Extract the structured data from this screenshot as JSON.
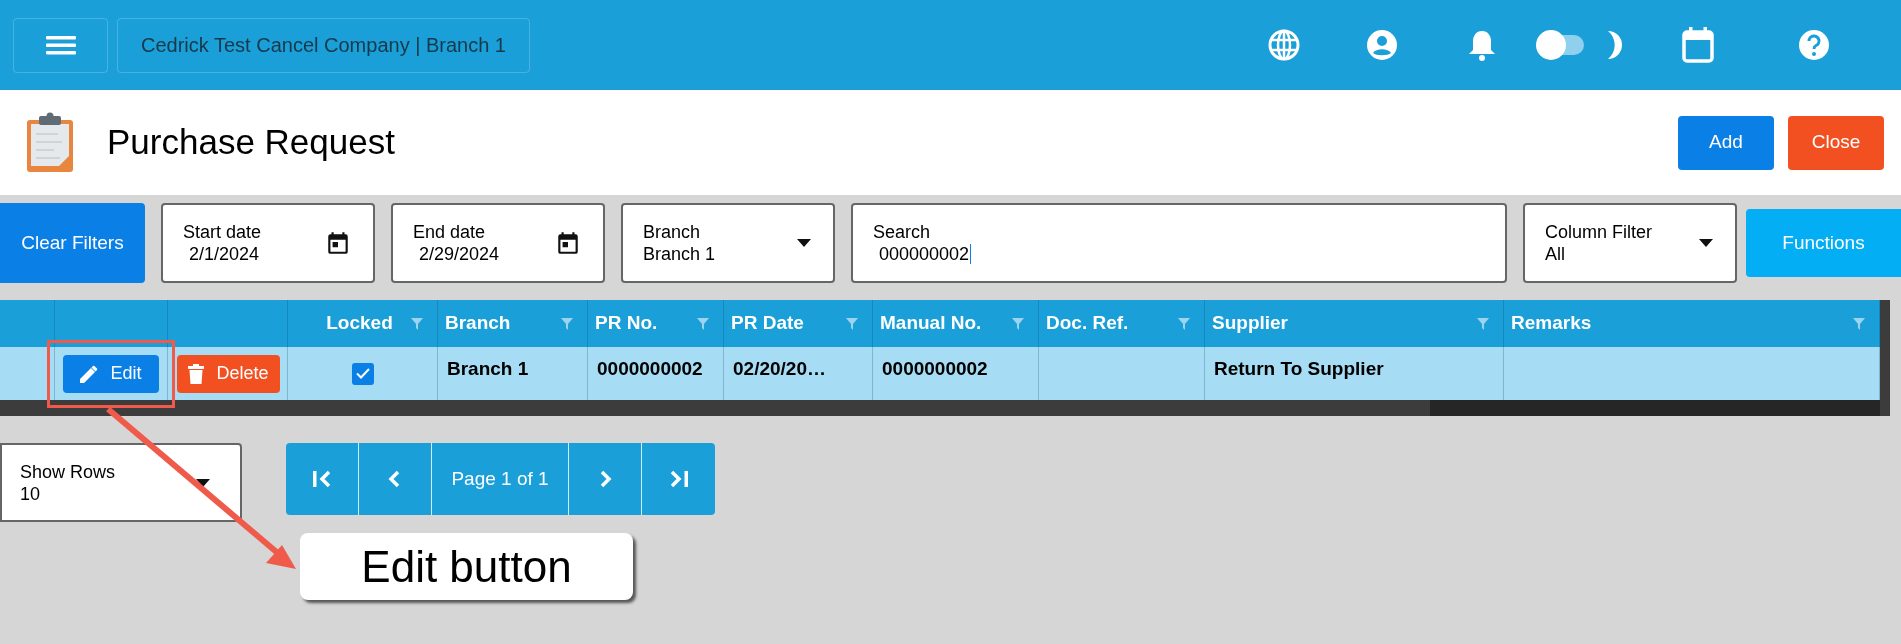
{
  "header": {
    "company": "Cedrick Test Cancel Company | Branch 1",
    "dark_mode": false
  },
  "page": {
    "title": "Purchase Request",
    "buttons": [
      {
        "kind": "primary",
        "label": "Add"
      },
      {
        "kind": "danger",
        "label": "Close"
      }
    ]
  },
  "filters": {
    "clear_label": "Clear Filters",
    "fields": [
      {
        "kind": "date",
        "label": "Start date",
        "value": "2/1/2024"
      },
      {
        "kind": "date",
        "label": "End date",
        "value": "2/29/2024"
      },
      {
        "kind": "select",
        "label": "Branch",
        "value": "Branch 1"
      },
      {
        "kind": "text",
        "label": "Search",
        "value": "000000002"
      },
      {
        "kind": "select",
        "label": "Column Filter",
        "value": "All"
      }
    ],
    "functions_label": "Functions"
  },
  "table": {
    "columns": [
      {
        "kind": "checkbox",
        "label": "Locked"
      },
      {
        "kind": "text",
        "label": "Branch"
      },
      {
        "kind": "text",
        "label": "PR No."
      },
      {
        "kind": "text",
        "label": "PR Date"
      },
      {
        "kind": "text",
        "label": "Manual No."
      },
      {
        "kind": "text",
        "label": "Doc. Ref."
      },
      {
        "kind": "text",
        "label": "Supplier"
      },
      {
        "kind": "text",
        "label": "Remarks"
      }
    ],
    "rows": [
      {
        "selected": true,
        "actions": [
          {
            "kind": "edit",
            "label": "Edit"
          },
          {
            "kind": "delete",
            "label": "Delete"
          }
        ],
        "locked": true,
        "cells": [
          "",
          "Branch 1",
          "0000000002",
          "02/20/20…",
          "0000000002",
          "",
          "Return To Supplier",
          ""
        ]
      }
    ]
  },
  "pager": {
    "show_rows_label": "Show Rows",
    "show_rows_value": "10",
    "page_label": "Page 1 of 1"
  },
  "annotation": {
    "label": "Edit button"
  }
}
